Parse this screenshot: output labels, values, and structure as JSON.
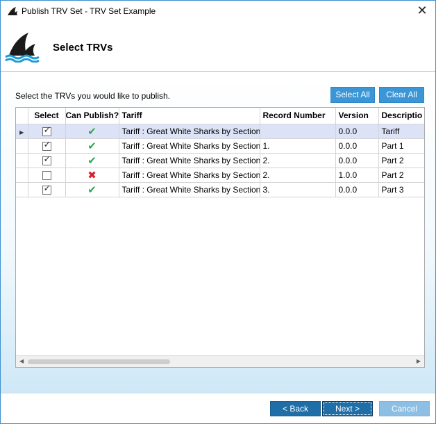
{
  "window": {
    "title": "Publish TRV Set - TRV Set Example",
    "close_glyph": "✕"
  },
  "header": {
    "title": "Select TRVs"
  },
  "main": {
    "instruction": "Select the TRVs you would like to publish.",
    "select_all_label": "Select All",
    "clear_all_label": "Clear All"
  },
  "table": {
    "columns": [
      "Select",
      "Can Publish?",
      "Tariff",
      "Record Number",
      "Version",
      "Descriptio"
    ],
    "rows": [
      {
        "selected": true,
        "can_publish": true,
        "tariff": "Tariff : Great White Sharks by Section",
        "record_number": "",
        "version": "0.0.0",
        "description": "Tariff"
      },
      {
        "selected": true,
        "can_publish": true,
        "tariff": "Tariff : Great White Sharks by Section",
        "record_number": "1.",
        "version": "0.0.0",
        "description": "Part 1"
      },
      {
        "selected": true,
        "can_publish": true,
        "tariff": "Tariff : Great White Sharks by Section",
        "record_number": "2.",
        "version": "0.0.0",
        "description": "Part 2"
      },
      {
        "selected": false,
        "can_publish": false,
        "tariff": "Tariff : Great White Sharks by Section",
        "record_number": "2.",
        "version": "1.0.0",
        "description": "Part 2"
      },
      {
        "selected": true,
        "can_publish": true,
        "tariff": "Tariff : Great White Sharks by Section",
        "record_number": "3.",
        "version": "0.0.0",
        "description": "Part 3"
      }
    ],
    "current_row": 0,
    "horizontal_scroll_fraction": 0.37
  },
  "footer": {
    "back_label": "< Back",
    "next_label": "Next >",
    "cancel_label": "Cancel"
  },
  "icons": {
    "check_glyph": "✔",
    "cross_glyph": "✖",
    "tick_glyph": "✓",
    "row_indicator_glyph": "▶",
    "scroll_left_glyph": "◀",
    "scroll_right_glyph": "▶"
  },
  "colors": {
    "accent": "#3a96d6",
    "next_button": "#1f6ea8",
    "cancel_button": "#8cbfe3",
    "check_green": "#2aa84a",
    "cross_red": "#d9202b",
    "selected_row": "#dde3f7",
    "shark_dark": "#1a1a1a",
    "wave_blue": "#1f9ad6"
  }
}
